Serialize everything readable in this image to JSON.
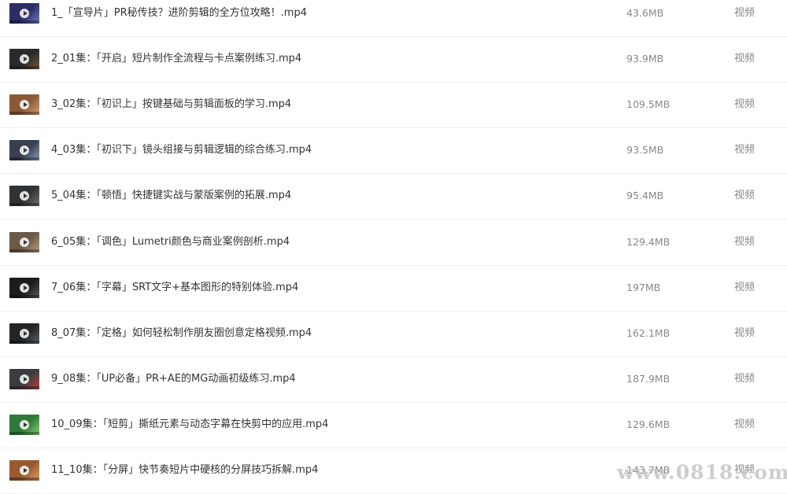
{
  "files": [
    {
      "name": "1_「宣导片」PR秘传技？进阶剪辑的全方位攻略！.mp4",
      "size": "43.6MB",
      "type": "视频",
      "thumb_color": "#2b2d66",
      "thumb_accent": "#6e7fc4"
    },
    {
      "name": "2_01集：「开启」短片制作全流程与卡点案例练习.mp4",
      "size": "93.9MB",
      "type": "视频",
      "thumb_color": "#2a2a2a",
      "thumb_accent": "#7a5a3a"
    },
    {
      "name": "3_02集：「初识上」按键基础与剪辑面板的学习.mp4",
      "size": "109.5MB",
      "type": "视频",
      "thumb_color": "#8a5a38",
      "thumb_accent": "#d8a070"
    },
    {
      "name": "4_03集：「初识下」镜头组接与剪辑逻辑的综合练习.mp4",
      "size": "93.5MB",
      "type": "视频",
      "thumb_color": "#3a4050",
      "thumb_accent": "#8aa0c0"
    },
    {
      "name": "5_04集：「顿悟」快捷键实战与蒙版案例的拓展.mp4",
      "size": "95.4MB",
      "type": "视频",
      "thumb_color": "#303234",
      "thumb_accent": "#707478"
    },
    {
      "name": "6_05集：「调色」Lumetri颜色与商业案例剖析.mp4",
      "size": "129.4MB",
      "type": "视频",
      "thumb_color": "#6a5a48",
      "thumb_accent": "#c0a080"
    },
    {
      "name": "7_06集：「字幕」SRT文字+基本图形的特别体验.mp4",
      "size": "197MB",
      "type": "视频",
      "thumb_color": "#1c1c1c",
      "thumb_accent": "#5a5a5a"
    },
    {
      "name": "8_07集：「定格」如何轻松制作朋友圈创意定格视频.mp4",
      "size": "162.1MB",
      "type": "视频",
      "thumb_color": "#222426",
      "thumb_accent": "#606468"
    },
    {
      "name": "9_08集：「UP必备」PR+AE的MG动画初级练习.mp4",
      "size": "187.9MB",
      "type": "视频",
      "thumb_color": "#3a3c40",
      "thumb_accent": "#c04040"
    },
    {
      "name": "10_09集：「短剪」撕纸元素与动态字幕在快剪中的应用.mp4",
      "size": "129.6MB",
      "type": "视频",
      "thumb_color": "#2f7a3a",
      "thumb_accent": "#8ad070"
    },
    {
      "name": "11_10集：「分屏」快节奏短片中硬核的分屏技巧拆解.mp4",
      "size": "143.7MB",
      "type": "视频",
      "thumb_color": "#9a5a30",
      "thumb_accent": "#e0a060"
    }
  ],
  "watermark": "www.0818.com"
}
